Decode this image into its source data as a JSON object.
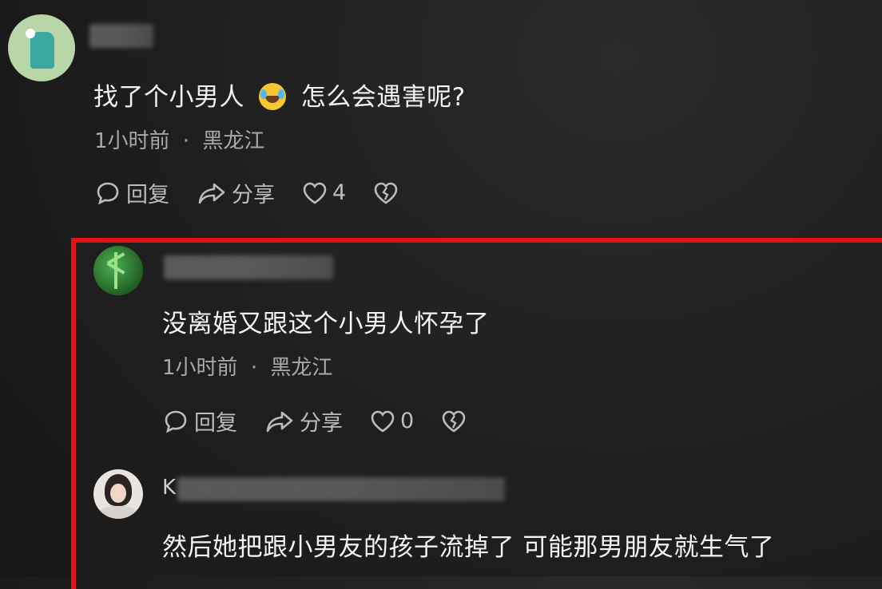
{
  "comments": [
    {
      "text": "找了个小男人",
      "text_after": "怎么会遇害呢?",
      "emoji": "laughing-crying",
      "time": "1小时前",
      "location": "黑龙江",
      "reply_label": "回复",
      "share_label": "分享",
      "likes": "4"
    },
    {
      "text": "没离婚又跟这个小男人怀孕了",
      "time": "1小时前",
      "location": "黑龙江",
      "reply_label": "回复",
      "share_label": "分享",
      "likes": "0"
    },
    {
      "name_initial": "K",
      "text": "然后她把跟小男友的孩子流掉了 可能那男朋友就生气了"
    }
  ],
  "separator": "·",
  "colors": {
    "highlight": "#e01414",
    "background": "#1c1c1c"
  }
}
